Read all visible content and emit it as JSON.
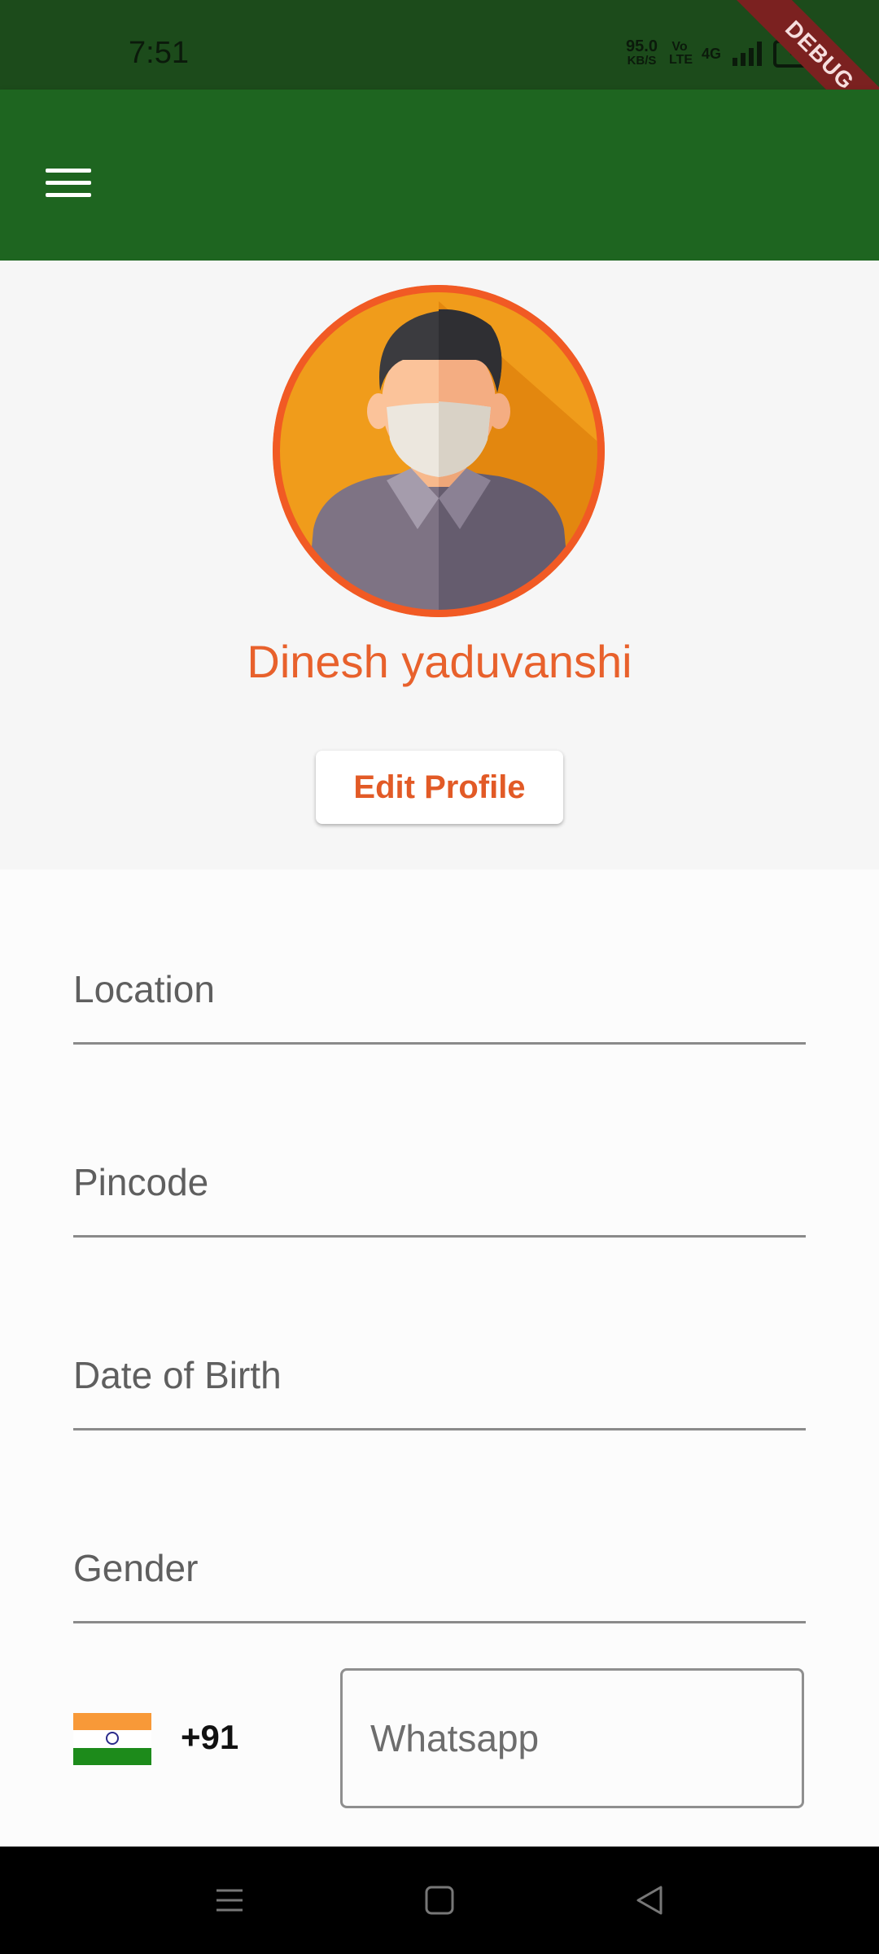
{
  "status_bar": {
    "time": "7:51",
    "net_speed": "95.0",
    "net_speed_unit": "KB/S",
    "volte": "Vo LTE",
    "network": "4G",
    "battery": "49"
  },
  "debug_banner": "DEBUG",
  "app_bar": {
    "menu_icon": "hamburger-menu-icon"
  },
  "profile": {
    "name": "Dinesh yaduvanshi",
    "edit_button": "Edit Profile",
    "avatar_icon": "masked-man-avatar"
  },
  "form": {
    "location_label": "Location",
    "pincode_label": "Pincode",
    "dob_label": "Date of Birth",
    "gender_label": "Gender",
    "country_flag": "india-flag-icon",
    "country_code": "+91",
    "whatsapp_placeholder": "Whatsapp"
  },
  "colors": {
    "status_bar": "#1c4b1b",
    "app_bar": "#1e6520",
    "accent_orange": "#e8612c",
    "avatar_ring": "#f15a24"
  },
  "nav_bar": {
    "recents": "recents-icon",
    "home": "home-icon",
    "back": "back-icon"
  }
}
